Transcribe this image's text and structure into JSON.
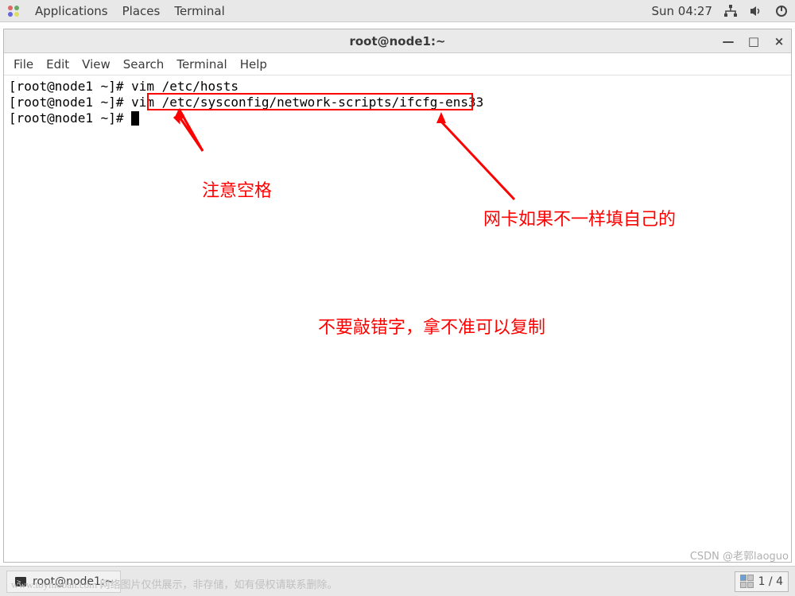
{
  "panel": {
    "applications": "Applications",
    "places": "Places",
    "terminal": "Terminal",
    "time": "Sun 04:27"
  },
  "window": {
    "title": "root@node1:~"
  },
  "menu": {
    "file": "File",
    "edit": "Edit",
    "view": "View",
    "search": "Search",
    "terminal": "Terminal",
    "help": "Help"
  },
  "terminal": {
    "prompt": "[root@node1 ~]# ",
    "line1_cmd": "vim /etc/hosts",
    "line2_cmd": "vim /etc/sysconfig/network-scripts/ifcfg-ens33",
    "line3_cmd": ""
  },
  "annotations": {
    "note_space": "注意空格",
    "note_nic": "网卡如果不一样填自己的",
    "note_typo": "不要敲错字，拿不准可以复制"
  },
  "taskbar": {
    "task_label": "root@node1:~",
    "workspace": "1 / 4"
  },
  "watermark": {
    "text": "www.toymoban.com 网络图片仅供展示，非存储，如有侵权请联系删除。",
    "csdn": "CSDN @老郭laoguo"
  }
}
